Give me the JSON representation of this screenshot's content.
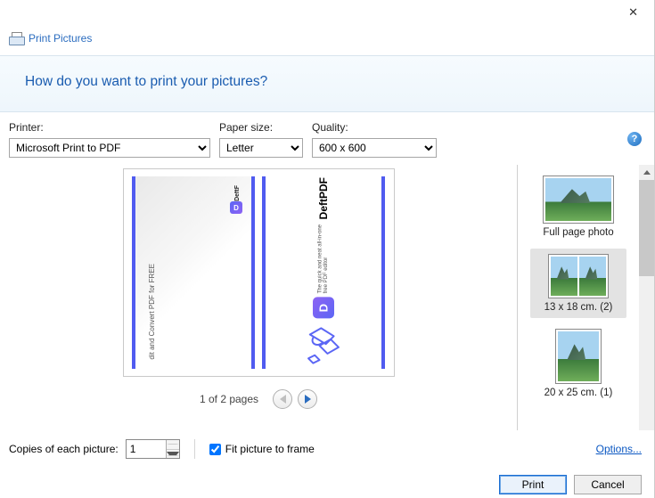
{
  "window": {
    "title": "Print Pictures"
  },
  "banner": {
    "heading": "How do you want to print your pictures?"
  },
  "controls": {
    "printer": {
      "label": "Printer:",
      "value": "Microsoft Print to PDF"
    },
    "paperSize": {
      "label": "Paper size:",
      "value": "Letter"
    },
    "quality": {
      "label": "Quality:",
      "value": "600 x 600"
    }
  },
  "preview": {
    "pageStatus": "1 of 2 pages",
    "left": {
      "sideText": "dit and Convert PDF for FREE",
      "brandSmall": "DeftF"
    },
    "right": {
      "brand": "DeftPDF",
      "tagline1": "The quick and neat all-in-one",
      "tagline2": "free PDF editor"
    }
  },
  "layouts": {
    "items": [
      {
        "label": "Full page photo"
      },
      {
        "label": "13 x 18 cm. (2)"
      },
      {
        "label": "20 x 25 cm. (1)"
      }
    ]
  },
  "lower": {
    "copiesLabel": "Copies of each picture:",
    "copiesValue": "1",
    "fitLabel": "Fit picture to frame",
    "optionsLink": "Options..."
  },
  "buttons": {
    "print": "Print",
    "cancel": "Cancel"
  }
}
